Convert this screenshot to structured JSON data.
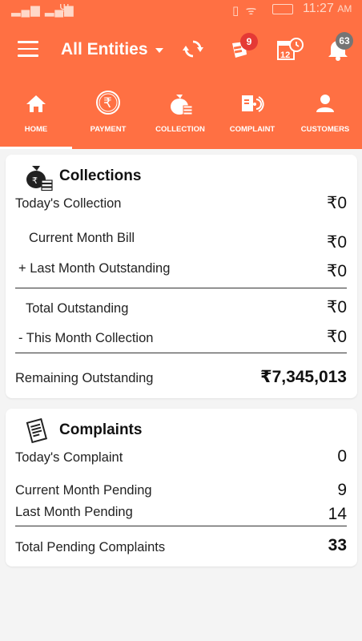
{
  "status_bar": {
    "signal": "▐▐▐ ▐▐ ",
    "time": "11:27",
    "ampm": "AM"
  },
  "toolbar": {
    "title": "All Entities",
    "cart_badge": "9",
    "notification_badge": "63",
    "accent": "#ff7043",
    "badge_red": "#e53935",
    "badge_gray": "#757575"
  },
  "tabs": [
    {
      "label": "HOME",
      "icon": "home-icon"
    },
    {
      "label": "PAYMENT",
      "icon": "rupee-icon"
    },
    {
      "label": "COLLECTION",
      "icon": "money-bag-icon"
    },
    {
      "label": "COMPLAINT",
      "icon": "complaint-icon"
    },
    {
      "label": "CUSTOMERS",
      "icon": "person-icon"
    }
  ],
  "collections": {
    "title": "Collections",
    "todays_label": "Today's Collection",
    "todays_value": "₹0",
    "current_bill_label": "Current Month  Bill",
    "current_bill_value": "₹0",
    "last_month_label": "+ Last Month Outstanding",
    "last_month_value": "₹0",
    "total_outstanding_label": "Total Outstanding",
    "total_outstanding_value": "₹0",
    "this_month_label": "- This Month Collection",
    "this_month_value": "₹0",
    "remaining_label": "Remaining Outstanding",
    "remaining_value": "₹7,345,013"
  },
  "complaints": {
    "title": "Complaints",
    "todays_label": "Today's Complaint",
    "todays_value": "0",
    "current_pending_label": "Current Month Pending",
    "current_pending_value": "9",
    "last_pending_label": "Last Month Pending",
    "last_pending_value": "14",
    "total_label": "Total Pending Complaints",
    "total_value": "33"
  }
}
